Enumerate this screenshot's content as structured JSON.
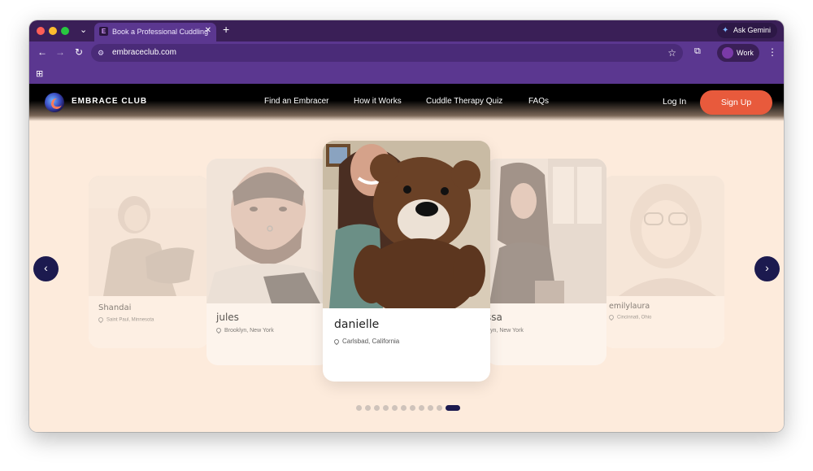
{
  "browser": {
    "tab_title": "Book a Professional Cuddling",
    "tab_favicon_letter": "E",
    "new_tab_symbol": "+",
    "close_symbol": "✕",
    "gemini_label": "Ask Gemini",
    "url": "embraceclub.com",
    "profile_label": "Work"
  },
  "site": {
    "brand": "EMBRACE CLUB",
    "nav": [
      "Find an Embracer",
      "How it Works",
      "Cuddle Therapy Quiz",
      "FAQs"
    ],
    "login": "Log In",
    "signup": "Sign Up",
    "colors": {
      "header": "#000000",
      "page_bg": "#fdebdc",
      "accent": "#e85a3c",
      "arrow": "#1c1a4f"
    }
  },
  "carousel": {
    "prev_symbol": "‹",
    "next_symbol": "›",
    "cards": [
      {
        "name": "Shandai",
        "location": "Saint Paul, Minnesota"
      },
      {
        "name": "jules",
        "location": "Brooklyn, New York"
      },
      {
        "name": "danielle",
        "location": "Carlsbad, California"
      },
      {
        "name": "ssa",
        "location": "klyn, New York"
      },
      {
        "name": "emilylaura",
        "location": "Cincinnati, Ohio"
      }
    ],
    "dot_count": 11,
    "active_dot": 10
  }
}
